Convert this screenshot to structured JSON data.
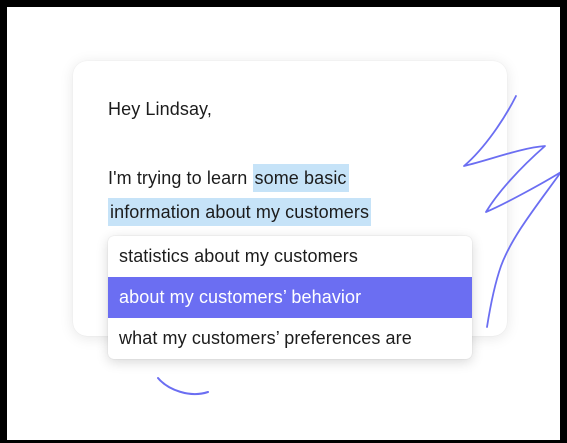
{
  "email": {
    "greeting": "Hey Lindsay,",
    "line1_prefix": "I'm trying to learn ",
    "line1_highlight": "some basic",
    "line2_highlight": "information about my customers"
  },
  "suggestions": {
    "selected_index": 1,
    "options": [
      "statistics about my customers",
      "about my customers’ behavior",
      "what my customers’ preferences are"
    ]
  },
  "colors": {
    "highlight": "#c6e3f8",
    "selected_option": "#6b6ef2",
    "scribble": "#6b6ef2"
  }
}
